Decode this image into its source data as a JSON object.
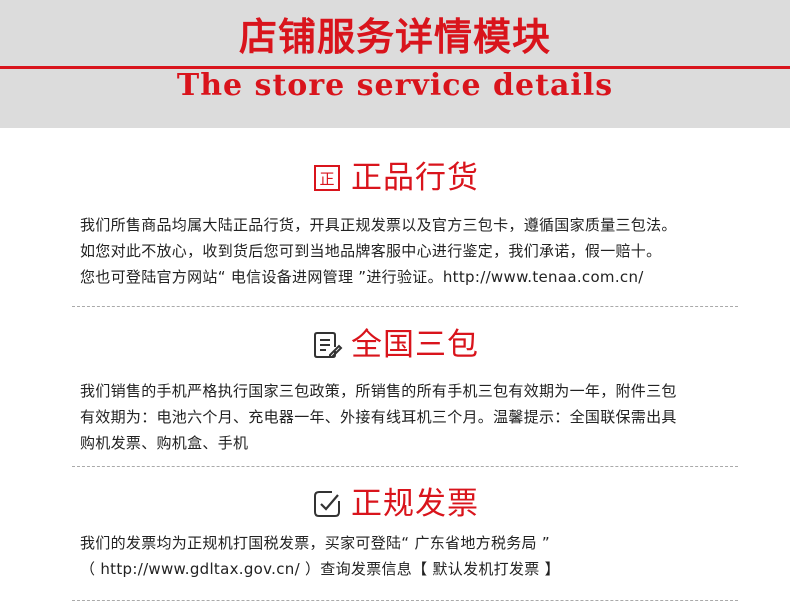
{
  "header": {
    "title": "店铺服务详情模块",
    "subtitle": "The store service details"
  },
  "sections": [
    {
      "icon": "genuine-seal-icon",
      "title": "正品行货",
      "lines": [
        "我们所售商品均属大陆正品行货，开具正规发票以及官方三包卡，遵循国家质量三包法。",
        "如您对此不放心，收到货后您可到当地品牌客服中心进行鉴定，我们承诺，假一赔十。",
        "您也可登陆官方网站“ 电信设备进网管理 ”进行验证。http://www.tenaa.com.cn/"
      ]
    },
    {
      "icon": "document-edit-icon",
      "title": "全国三包",
      "lines": [
        "我们销售的手机严格执行国家三包政策，所销售的所有手机三包有效期为一年，附件三包",
        "有效期为：电池六个月、充电器一年、外接有线耳机三个月。温馨提示：全国联保需出具",
        "购机发票、购机盒、手机"
      ]
    },
    {
      "icon": "check-box-icon",
      "title": "正规发票",
      "lines": [
        "我们的发票均为正规机打国税发票，买家可登陆“ 广东省地方税务局 ”",
        "（ http://www.gdltax.gov.cn/ ）查询发票信息【 默认发机打发票 】"
      ]
    }
  ],
  "colors": {
    "accent": "#d9141c",
    "header_bg": "#dcdcdc",
    "text": "#222222"
  }
}
